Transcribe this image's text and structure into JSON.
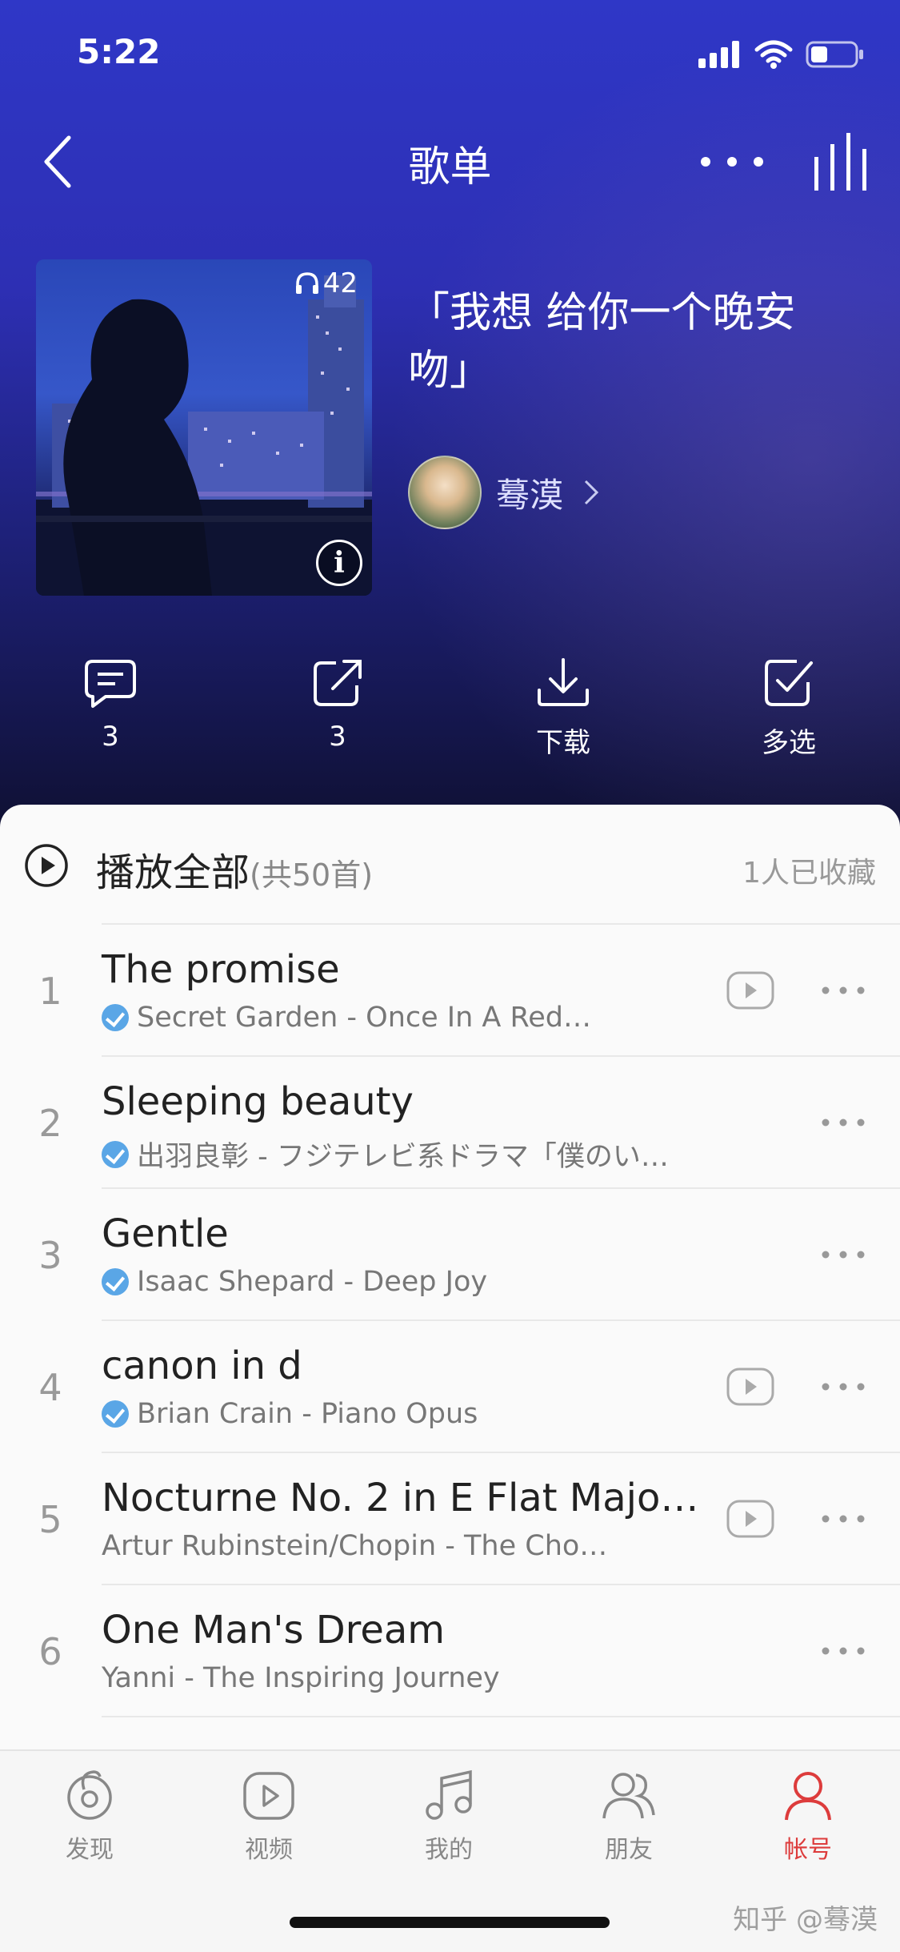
{
  "status_bar": {
    "time": "5:22"
  },
  "nav": {
    "title": "歌单"
  },
  "playlist": {
    "play_count": "42",
    "title": "「我想 给你一个晚安吻」",
    "creator": "蓦漠"
  },
  "actions": [
    {
      "icon": "comment-icon",
      "label": "3"
    },
    {
      "icon": "share-icon",
      "label": "3"
    },
    {
      "icon": "download-icon",
      "label": "下载"
    },
    {
      "icon": "multi-select-icon",
      "label": "多选"
    }
  ],
  "play_all": {
    "label": "播放全部",
    "count": "(共50首)",
    "collected": "1人已收藏"
  },
  "songs": [
    {
      "num": "1",
      "title": "The promise",
      "subtitle": "Secret Garden - Once In A Red…",
      "verified": true,
      "mv": true
    },
    {
      "num": "2",
      "title": "Sleeping beauty",
      "subtitle": "出羽良彰 - フジテレビ系ドラマ「僕のい…",
      "verified": true,
      "mv": false
    },
    {
      "num": "3",
      "title": "Gentle",
      "subtitle": "Isaac Shepard - Deep Joy",
      "verified": true,
      "mv": false
    },
    {
      "num": "4",
      "title": "canon in d",
      "subtitle": "Brian Crain - Piano Opus",
      "verified": true,
      "mv": true
    },
    {
      "num": "5",
      "title": "Nocturne No. 2 in E Flat Majo…",
      "subtitle": "Artur Rubinstein/Chopin - The Cho…",
      "verified": false,
      "mv": true
    },
    {
      "num": "6",
      "title": "One Man's Dream",
      "subtitle": "Yanni - The Inspiring Journey",
      "verified": false,
      "mv": false
    }
  ],
  "tabs": [
    {
      "icon": "discover-icon",
      "label": "发现",
      "active": false
    },
    {
      "icon": "video-icon",
      "label": "视频",
      "active": false
    },
    {
      "icon": "music-note-icon",
      "label": "我的",
      "active": false
    },
    {
      "icon": "friends-icon",
      "label": "朋友",
      "active": false
    },
    {
      "icon": "account-icon",
      "label": "帐号",
      "active": true
    }
  ],
  "watermark": "知乎 @蓦漠",
  "colors": {
    "accent": "#dd3c3c",
    "verified": "#5aa6e6",
    "hero_top": "#2f37c7",
    "hero_bottom": "#0f1032"
  }
}
